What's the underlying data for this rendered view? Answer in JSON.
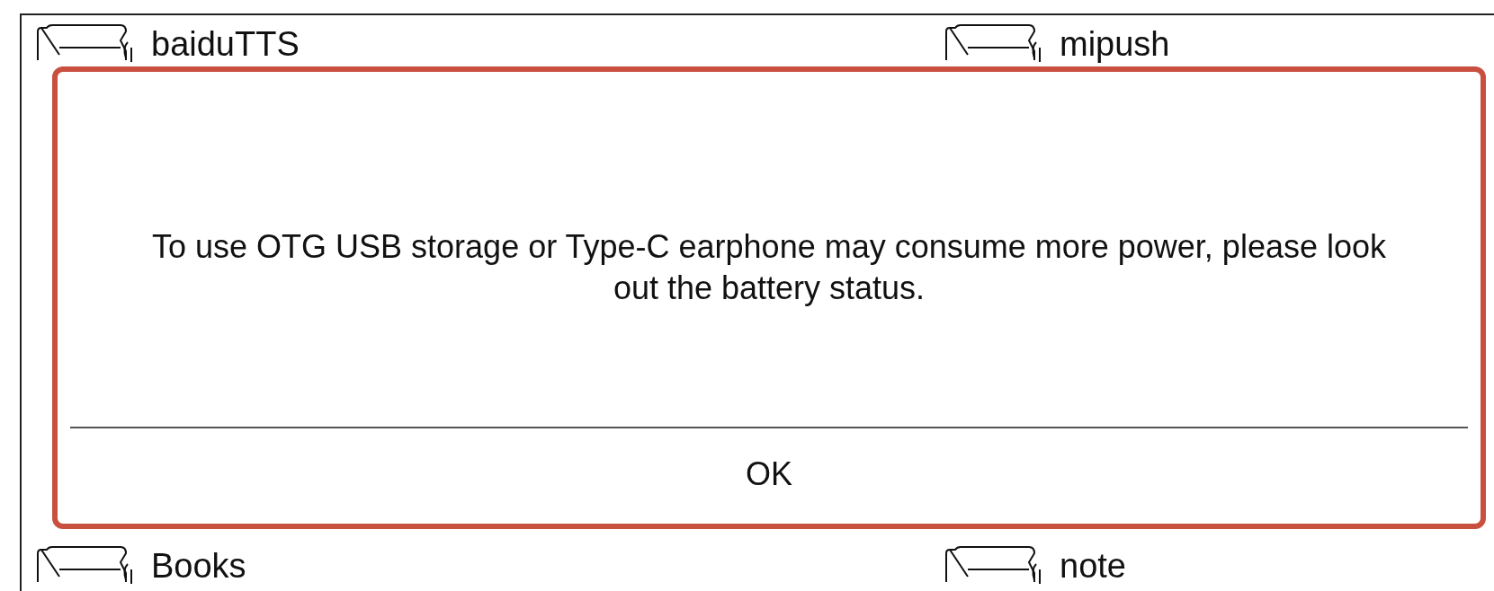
{
  "folders": [
    {
      "name": "baiduTTS"
    },
    {
      "name": "mipush"
    },
    {
      "name": "Books"
    },
    {
      "name": "note"
    }
  ],
  "dialog": {
    "message": "To use OTG USB storage or Type-C earphone may consume more power, please look out the battery status.",
    "button": "OK"
  }
}
